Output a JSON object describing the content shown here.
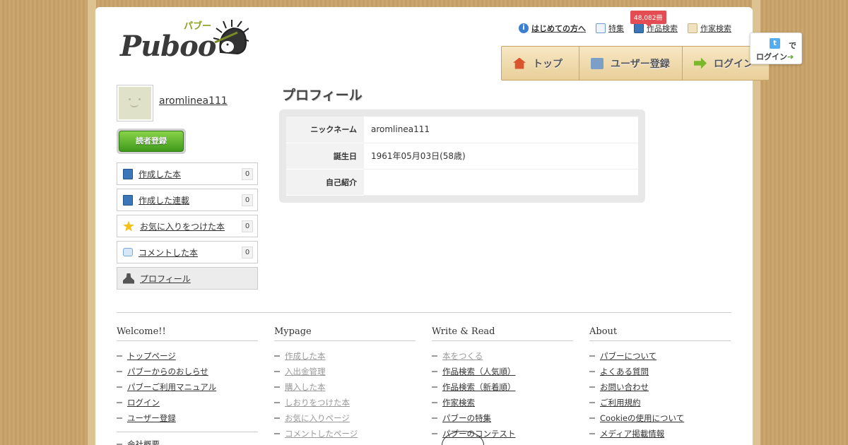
{
  "header": {
    "logo_text": "Puboo",
    "logo_kana": "パブー",
    "links": [
      {
        "label": "はじめての方へ",
        "icon": "info-icon"
      },
      {
        "label": "特集",
        "icon": "open-book-icon"
      },
      {
        "label": "作品検索",
        "icon": "book-icon",
        "badge": "48,082冊"
      },
      {
        "label": "作家検索",
        "icon": "writer-face-icon"
      }
    ],
    "nav": [
      {
        "label": "トップ",
        "icon": "home-icon"
      },
      {
        "label": "ユーザー登録",
        "icon": "pencil-icon"
      },
      {
        "label": "ログイン",
        "icon": "arrow-right-icon"
      }
    ],
    "twitter": {
      "de": "で",
      "login": "ログイン"
    }
  },
  "sidebar": {
    "username": "aromlinea111",
    "follow_label": "読者登録",
    "menu": [
      {
        "label": "作成した本",
        "count": "0"
      },
      {
        "label": "作成した連載",
        "count": "0"
      },
      {
        "label": "お気に入りをつけた本",
        "count": "0"
      },
      {
        "label": "コメントした本",
        "count": "0"
      },
      {
        "label": "プロフィール"
      }
    ]
  },
  "profile": {
    "title": "プロフィール",
    "rows": [
      {
        "label": "ニックネーム",
        "value": "aromlinea111"
      },
      {
        "label": "誕生日",
        "value": "1961年05月03日(58歳)"
      },
      {
        "label": "自己紹介",
        "value": ""
      }
    ]
  },
  "footer": {
    "columns": [
      {
        "title": "Welcome!!",
        "items": [
          "トップページ",
          "パブーからのおしらせ",
          "パブーご利用マニュアル",
          "ログイン",
          "ユーザー登録"
        ],
        "extra": "会社概要"
      },
      {
        "title": "Mypage",
        "items": [
          "作成した本",
          "入出金管理",
          "購入した本",
          "しおりをつけた本",
          "お気に入りページ",
          "コメントしたページ"
        ]
      },
      {
        "title": "Write & Read",
        "items": [
          "本をつくる",
          "作品検索（人気順）",
          "作品検索（新着順）",
          "作家検索",
          "パブーの特集",
          "パブーのコンテスト"
        ]
      },
      {
        "title": "About",
        "items": [
          "パブーについて",
          "よくある質問",
          "お問い合わせ",
          "ご利用規約",
          "Cookieの使用について",
          "メディア掲載情報"
        ]
      }
    ]
  }
}
